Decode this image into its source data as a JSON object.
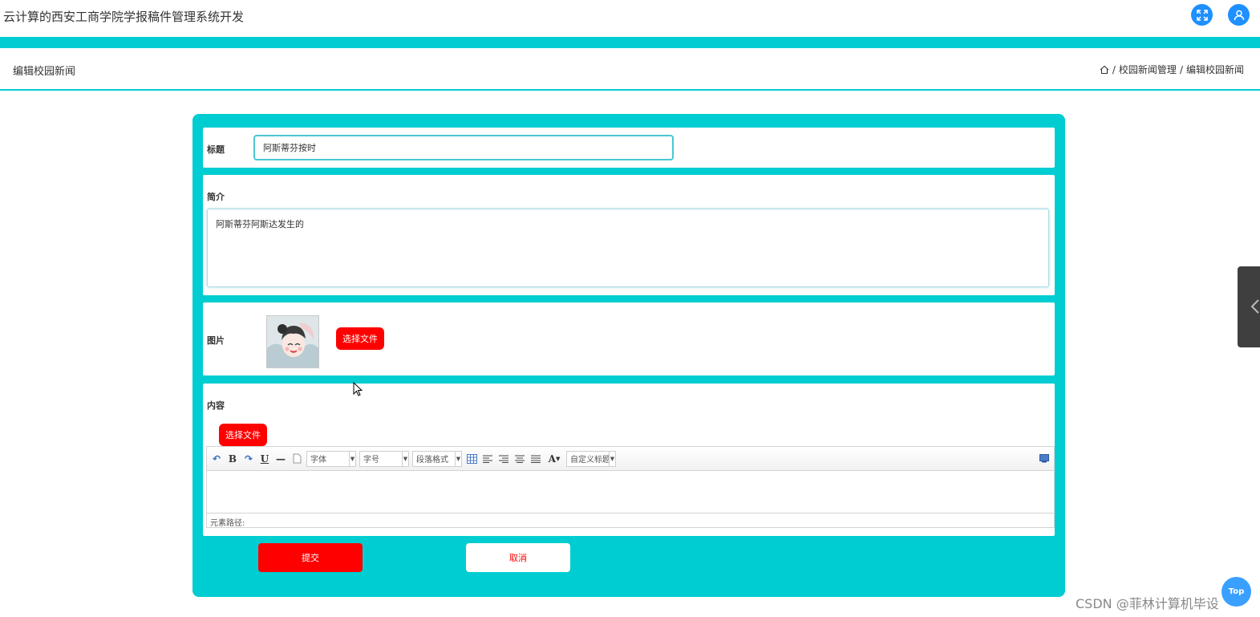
{
  "header": {
    "app_title": "云计算的西安工商学院学报稿件管理系统开发",
    "fullscreen_icon": "fullscreen-icon",
    "user_icon": "user-icon"
  },
  "page": {
    "title": "编辑校园新闻",
    "breadcrumb": [
      "校园新闻管理",
      "编辑校园新闻"
    ],
    "breadcrumb_sep": "/"
  },
  "form": {
    "title_label": "标题",
    "title_value": "阿斯蒂芬按时",
    "intro_label": "简介",
    "intro_value": "阿斯蒂芬阿斯达发生的",
    "image_label": "图片",
    "image_button": "选择文件",
    "content_label": "内容",
    "content_button": "选择文件",
    "editor": {
      "font_select": "字体",
      "size_select": "字号",
      "paragraph_select": "段落格式",
      "custom_title_select": "自定义标题",
      "status_text": "元素路径:"
    },
    "submit_label": "提交",
    "cancel_label": "取消"
  },
  "floating": {
    "top_button": "Top",
    "watermark": "CSDN @菲林计算机毕设"
  },
  "colors": {
    "accent_teal": "#00cdd1",
    "button_red": "#ff0000",
    "icon_blue": "#1e90ff"
  }
}
